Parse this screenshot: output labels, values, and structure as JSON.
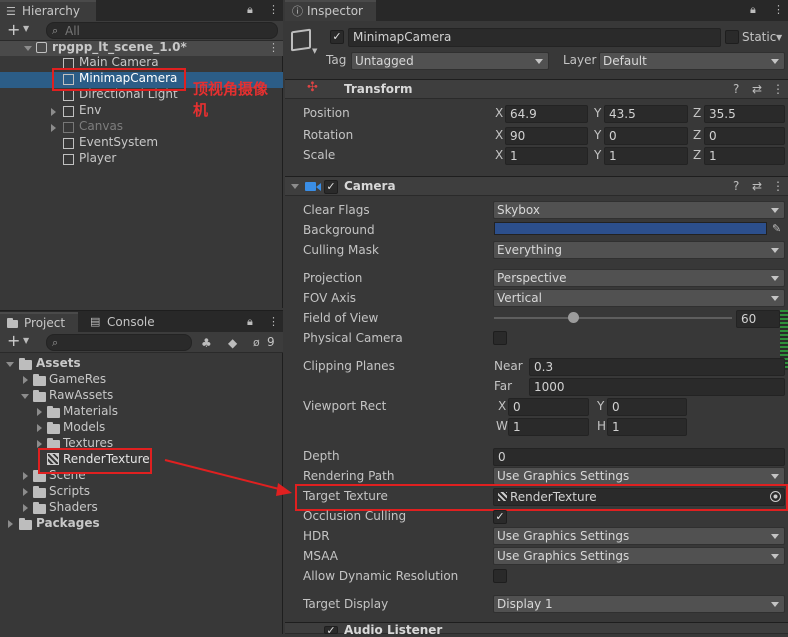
{
  "hierarchy": {
    "tab_label": "Hierarchy",
    "search_placeholder": "All",
    "scene_name": "rpgpp_lt_scene_1.0*",
    "items": [
      "Main Camera",
      "MinimapCamera",
      "Directional Light",
      "Env",
      "Canvas",
      "EventSystem",
      "Player"
    ]
  },
  "annotation": "顶视角摄像机",
  "project": {
    "tab_project": "Project",
    "tab_console": "Console",
    "hidden_count": "9",
    "assets": "Assets",
    "items": [
      "GameRes",
      "RawAssets",
      "Materials",
      "Models",
      "Textures",
      "RenderTexture",
      "Scene",
      "Scripts",
      "Shaders"
    ],
    "packages": "Packages"
  },
  "inspector": {
    "tab_label": "Inspector",
    "object_name": "MinimapCamera",
    "static_label": "Static",
    "tag_label": "Tag",
    "tag_value": "Untagged",
    "layer_label": "Layer",
    "layer_value": "Default",
    "transform": {
      "title": "Transform",
      "position_label": "Position",
      "rotation_label": "Rotation",
      "scale_label": "Scale",
      "x": "X",
      "y": "Y",
      "z": "Z",
      "position": [
        "64.9",
        "43.5",
        "35.5"
      ],
      "rotation": [
        "90",
        "0",
        "0"
      ],
      "scale": [
        "1",
        "1",
        "1"
      ]
    },
    "camera": {
      "title": "Camera",
      "clear_flags_label": "Clear Flags",
      "clear_flags": "Skybox",
      "background_label": "Background",
      "background_color": "#2c4f8c",
      "culling_mask_label": "Culling Mask",
      "culling_mask": "Everything",
      "projection_label": "Projection",
      "projection": "Perspective",
      "fov_axis_label": "FOV Axis",
      "fov_axis": "Vertical",
      "fov_label": "Field of View",
      "fov_value": "60",
      "physical_label": "Physical Camera",
      "clipping_label": "Clipping Planes",
      "near_label": "Near",
      "near": "0.3",
      "far_label": "Far",
      "far": "1000",
      "viewport_label": "Viewport Rect",
      "vx_label": "X",
      "vx": "0",
      "vy_label": "Y",
      "vy": "0",
      "vw_label": "W",
      "vw": "1",
      "vh_label": "H",
      "vh": "1",
      "depth_label": "Depth",
      "depth": "0",
      "rendering_path_label": "Rendering Path",
      "rendering_path": "Use Graphics Settings",
      "target_texture_label": "Target Texture",
      "target_texture": "RenderTexture",
      "occlusion_label": "Occlusion Culling",
      "hdr_label": "HDR",
      "hdr": "Use Graphics Settings",
      "msaa_label": "MSAA",
      "msaa": "Use Graphics Settings",
      "dynres_label": "Allow Dynamic Resolution",
      "target_display_label": "Target Display",
      "target_display": "Display 1"
    },
    "audio_listener": "Audio Listener"
  },
  "colors": {
    "highlight": "#2c5d87",
    "annotation_red": "#e02020"
  }
}
